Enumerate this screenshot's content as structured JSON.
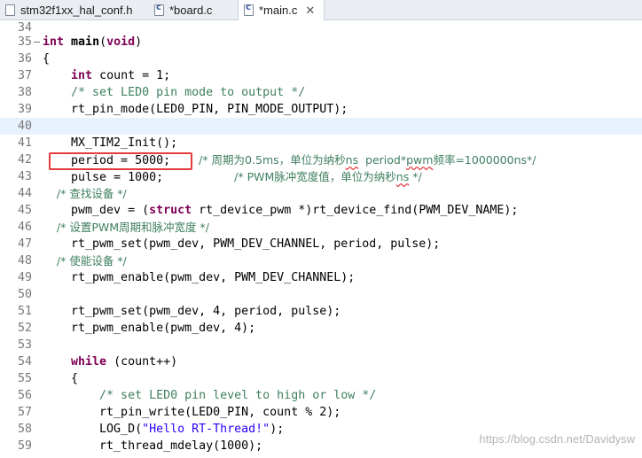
{
  "tabs": [
    {
      "label": "stm32f1xx_hal_conf.h"
    },
    {
      "label": "*board.c"
    },
    {
      "label": "*main.c",
      "close": "✕"
    }
  ],
  "watermark": "https://blog.csdn.net/Davidysw",
  "highlight_color": "#e53a3a",
  "lines": [
    {
      "n": "34",
      "code": ""
    },
    {
      "n": "35",
      "code": "int main(void)"
    },
    {
      "n": "36",
      "code": "{"
    },
    {
      "n": "37",
      "code": "    int count = 1;"
    },
    {
      "n": "38",
      "code": "    /* set LED0 pin mode to output */"
    },
    {
      "n": "39",
      "code": "    rt_pin_mode(LED0_PIN, PIN_MODE_OUTPUT);"
    },
    {
      "n": "40",
      "code": ""
    },
    {
      "n": "41",
      "code": "    MX_TIM2_Init();"
    },
    {
      "n": "42",
      "code": "    period = 5000;    /* 周期为0.5ms，单位为纳秒ns  period*pwm频率=1000000ns*/"
    },
    {
      "n": "43",
      "code": "    pulse = 1000;          /* PWM脉冲宽度值，单位为纳秒ns */"
    },
    {
      "n": "44",
      "code": "    /* 查找设备 */"
    },
    {
      "n": "45",
      "code": "    pwm_dev = (struct rt_device_pwm *)rt_device_find(PWM_DEV_NAME);"
    },
    {
      "n": "46",
      "code": "    /* 设置PWM周期和脉冲宽度 */"
    },
    {
      "n": "47",
      "code": "    rt_pwm_set(pwm_dev, PWM_DEV_CHANNEL, period, pulse);"
    },
    {
      "n": "48",
      "code": "    /* 使能设备 */"
    },
    {
      "n": "49",
      "code": "    rt_pwm_enable(pwm_dev, PWM_DEV_CHANNEL);"
    },
    {
      "n": "50",
      "code": ""
    },
    {
      "n": "51",
      "code": "    rt_pwm_set(pwm_dev, 4, period, pulse);"
    },
    {
      "n": "52",
      "code": "    rt_pwm_enable(pwm_dev, 4);"
    },
    {
      "n": "53",
      "code": ""
    },
    {
      "n": "54",
      "code": "    while (count++)"
    },
    {
      "n": "55",
      "code": "    {"
    },
    {
      "n": "56",
      "code": "        /* set LED0 pin level to high or low */"
    },
    {
      "n": "57",
      "code": "        rt_pin_write(LED0_PIN, count % 2);"
    },
    {
      "n": "58",
      "code": "        LOG_D(\"Hello RT-Thread!\");"
    },
    {
      "n": "59",
      "code": "        rt_thread_mdelay(1000);"
    }
  ]
}
